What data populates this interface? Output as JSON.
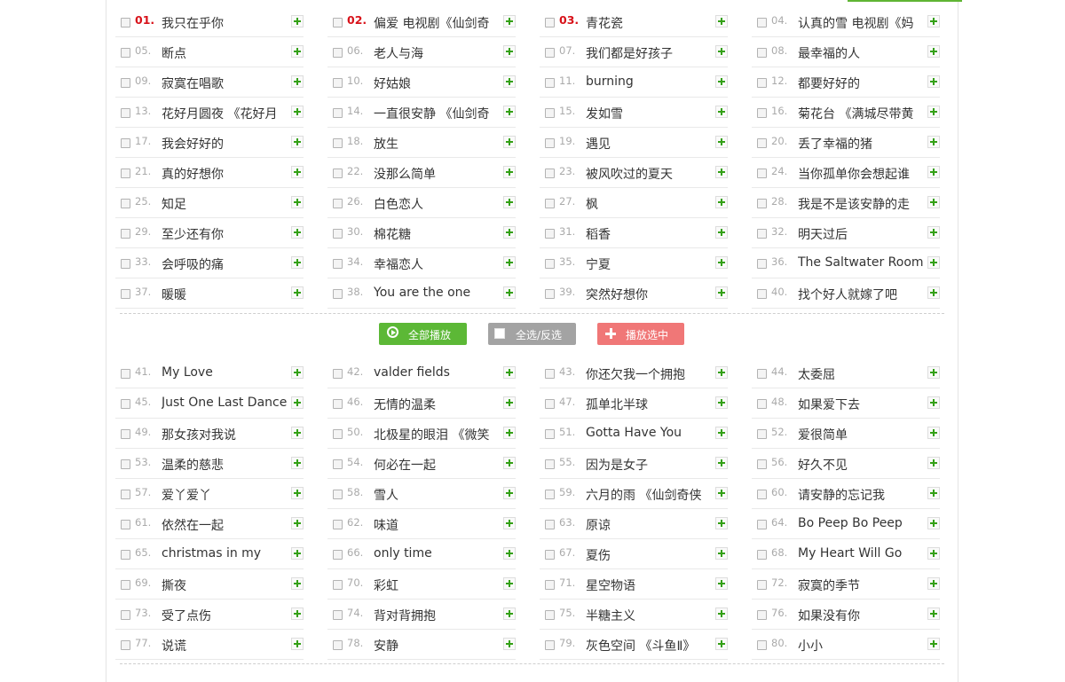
{
  "theme": {
    "hot_number_color": "#d8121a",
    "add_icon_color": "#33a014",
    "play_all_color": "#5cb836",
    "select_all_color": "#a3a3a3",
    "play_selected_color": "#f07777"
  },
  "buttons": {
    "play_all": "全部播放",
    "select_all": "全选/反选",
    "play_selected": "播放选中"
  },
  "songs_top": [
    {
      "num": "01.",
      "title": "我只在乎你"
    },
    {
      "num": "02.",
      "title": "偏爱 电视剧《仙剑奇"
    },
    {
      "num": "03.",
      "title": "青花瓷"
    },
    {
      "num": "04.",
      "title": "认真的雪 电视剧《妈"
    },
    {
      "num": "05.",
      "title": "断点"
    },
    {
      "num": "06.",
      "title": "老人与海"
    },
    {
      "num": "07.",
      "title": "我们都是好孩子"
    },
    {
      "num": "08.",
      "title": "最幸福的人"
    },
    {
      "num": "09.",
      "title": "寂寞在唱歌"
    },
    {
      "num": "10.",
      "title": "好姑娘"
    },
    {
      "num": "11.",
      "title": "burning"
    },
    {
      "num": "12.",
      "title": "都要好好的"
    },
    {
      "num": "13.",
      "title": "花好月圆夜 《花好月"
    },
    {
      "num": "14.",
      "title": "一直很安静 《仙剑奇"
    },
    {
      "num": "15.",
      "title": "发如雪"
    },
    {
      "num": "16.",
      "title": "菊花台 《满城尽带黄"
    },
    {
      "num": "17.",
      "title": "我会好好的"
    },
    {
      "num": "18.",
      "title": "放生"
    },
    {
      "num": "19.",
      "title": "遇见"
    },
    {
      "num": "20.",
      "title": "丢了幸福的猪"
    },
    {
      "num": "21.",
      "title": "真的好想你"
    },
    {
      "num": "22.",
      "title": "没那么简单"
    },
    {
      "num": "23.",
      "title": "被风吹过的夏天"
    },
    {
      "num": "24.",
      "title": "当你孤单你会想起谁"
    },
    {
      "num": "25.",
      "title": "知足"
    },
    {
      "num": "26.",
      "title": "白色恋人"
    },
    {
      "num": "27.",
      "title": "枫"
    },
    {
      "num": "28.",
      "title": "我是不是该安静的走"
    },
    {
      "num": "29.",
      "title": "至少还有你"
    },
    {
      "num": "30.",
      "title": "棉花糖"
    },
    {
      "num": "31.",
      "title": "稻香"
    },
    {
      "num": "32.",
      "title": "明天过后"
    },
    {
      "num": "33.",
      "title": "会呼吸的痛"
    },
    {
      "num": "34.",
      "title": "幸福恋人"
    },
    {
      "num": "35.",
      "title": "宁夏"
    },
    {
      "num": "36.",
      "title": "The Saltwater Room"
    },
    {
      "num": "37.",
      "title": "暖暖"
    },
    {
      "num": "38.",
      "title": "You are the one"
    },
    {
      "num": "39.",
      "title": "突然好想你"
    },
    {
      "num": "40.",
      "title": "找个好人就嫁了吧"
    }
  ],
  "songs_bottom": [
    {
      "num": "41.",
      "title": "My Love"
    },
    {
      "num": "42.",
      "title": "valder fields"
    },
    {
      "num": "43.",
      "title": "你还欠我一个拥抱"
    },
    {
      "num": "44.",
      "title": "太委屈"
    },
    {
      "num": "45.",
      "title": "Just One Last Dance"
    },
    {
      "num": "46.",
      "title": "无情的温柔"
    },
    {
      "num": "47.",
      "title": "孤单北半球"
    },
    {
      "num": "48.",
      "title": "如果爱下去"
    },
    {
      "num": "49.",
      "title": "那女孩对我说"
    },
    {
      "num": "50.",
      "title": "北极星的眼泪 《微笑"
    },
    {
      "num": "51.",
      "title": "Gotta Have You"
    },
    {
      "num": "52.",
      "title": "爱很简单"
    },
    {
      "num": "53.",
      "title": "温柔的慈悲"
    },
    {
      "num": "54.",
      "title": "何必在一起"
    },
    {
      "num": "55.",
      "title": "因为是女子"
    },
    {
      "num": "56.",
      "title": "好久不见"
    },
    {
      "num": "57.",
      "title": "爱丫爱丫"
    },
    {
      "num": "58.",
      "title": "雪人"
    },
    {
      "num": "59.",
      "title": "六月的雨 《仙剑奇侠"
    },
    {
      "num": "60.",
      "title": "请安静的忘记我"
    },
    {
      "num": "61.",
      "title": "依然在一起"
    },
    {
      "num": "62.",
      "title": "味道"
    },
    {
      "num": "63.",
      "title": "原谅"
    },
    {
      "num": "64.",
      "title": "Bo Peep Bo Peep"
    },
    {
      "num": "65.",
      "title": "christmas in my"
    },
    {
      "num": "66.",
      "title": "only time"
    },
    {
      "num": "67.",
      "title": "夏伤"
    },
    {
      "num": "68.",
      "title": "My Heart Will Go"
    },
    {
      "num": "69.",
      "title": "撕夜"
    },
    {
      "num": "70.",
      "title": "彩虹"
    },
    {
      "num": "71.",
      "title": "星空物语"
    },
    {
      "num": "72.",
      "title": "寂寞的季节"
    },
    {
      "num": "73.",
      "title": "受了点伤"
    },
    {
      "num": "74.",
      "title": "背对背拥抱"
    },
    {
      "num": "75.",
      "title": "半糖主义"
    },
    {
      "num": "76.",
      "title": "如果没有你"
    },
    {
      "num": "77.",
      "title": "说谎"
    },
    {
      "num": "78.",
      "title": "安静"
    },
    {
      "num": "79.",
      "title": "灰色空间 《斗鱼Ⅱ》"
    },
    {
      "num": "80.",
      "title": "小小"
    }
  ]
}
